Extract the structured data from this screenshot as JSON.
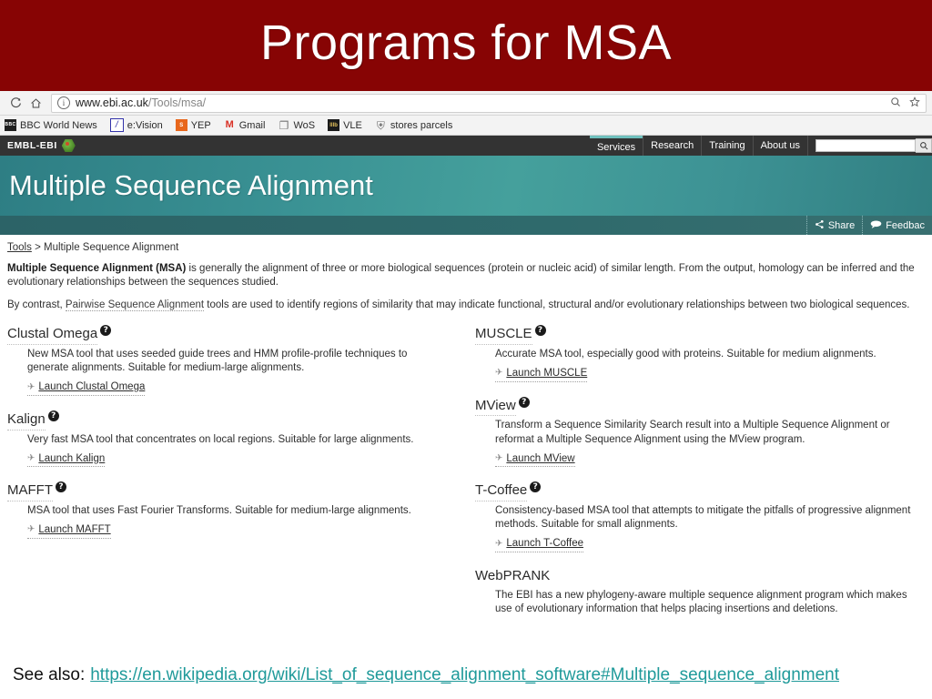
{
  "slide": {
    "title": "Programs for MSA",
    "title_bg": "#870404",
    "see_also_label": "See also:",
    "see_also_link": "https://en.wikipedia.org/wiki/List_of_sequence_alignment_software#Multiple_sequence_alignment",
    "link_color": "#1f9a9a"
  },
  "browser": {
    "reload_icon": "reload-icon",
    "home_icon": "home-icon",
    "info_icon": "info-icon",
    "url_host": "www.ebi.ac.uk",
    "url_path": "/Tools/msa/",
    "zoom_out_icon": "zoom-out-icon",
    "star_icon": "star-icon",
    "bookmarks": [
      {
        "label": "BBC World News",
        "icon": "bbc-icon",
        "glyph": "BBC"
      },
      {
        "label": "e:Vision",
        "icon": "evision-icon",
        "glyph": "/"
      },
      {
        "label": "YEP",
        "icon": "yep-icon",
        "glyph": "S"
      },
      {
        "label": "Gmail",
        "icon": "gmail-icon",
        "glyph": "M"
      },
      {
        "label": "WoS",
        "icon": "wos-page-icon",
        "glyph": "❐"
      },
      {
        "label": "VLE",
        "icon": "vle-icon",
        "glyph": "lllb"
      },
      {
        "label": "stores parcels",
        "icon": "shield-icon",
        "glyph": "⛨"
      }
    ]
  },
  "site": {
    "brand": "EMBL-EBI",
    "brand_logo_icon": "embl-ebi-hexagon-logo",
    "nav": [
      {
        "label": "Services",
        "active": true
      },
      {
        "label": "Research",
        "active": false
      },
      {
        "label": "Training",
        "active": false
      },
      {
        "label": "About us",
        "active": false
      }
    ],
    "search_placeholder": "",
    "search_value": "",
    "search_icon": "search-icon",
    "hero_title": "Multiple Sequence Alignment",
    "hero_color": "#3a9294",
    "share_label": "Share",
    "share_icon": "share-icon",
    "feedback_label": "Feedbac",
    "feedback_icon": "speech-bubble-icon"
  },
  "page": {
    "breadcrumb_root": "Tools",
    "breadcrumb_sep": ">",
    "breadcrumb_current": "Multiple Sequence Alignment",
    "intro_bold": "Multiple Sequence Alignment (MSA)",
    "intro_rest": " is generally the alignment of three or more biological sequences (protein or nucleic acid) of similar length. From the output, homology can be inferred and the evolutionary relationships between the sequences studied.",
    "contrast_pre": "By contrast, ",
    "contrast_link": "Pairwise Sequence Alignment",
    "contrast_post": " tools are used to identify regions of similarity that may indicate functional, structural and/or evolutionary relationships between two biological sequences.",
    "help_icon": "help-question-icon",
    "launch_icon": "wrench-icon"
  },
  "tools_left": [
    {
      "name": "Clustal Omega",
      "has_help": true,
      "description": "New MSA tool that uses seeded guide trees and HMM profile-profile techniques to generate alignments. Suitable for medium-large alignments.",
      "launch": "Launch Clustal Omega"
    },
    {
      "name": "Kalign",
      "has_help": true,
      "description": "Very fast MSA tool that concentrates on local regions. Suitable for large alignments.",
      "launch": "Launch Kalign"
    },
    {
      "name": "MAFFT",
      "has_help": true,
      "description": "MSA tool that uses Fast Fourier Transforms. Suitable for medium-large alignments.",
      "launch": "Launch MAFFT"
    }
  ],
  "tools_right": [
    {
      "name": "MUSCLE",
      "has_help": true,
      "description": "Accurate MSA tool, especially good with proteins. Suitable for medium alignments.",
      "launch": "Launch MUSCLE"
    },
    {
      "name": "MView",
      "has_help": true,
      "description": "Transform a Sequence Similarity Search result into a Multiple Sequence Alignment or reformat a Multiple Sequence Alignment using the MView program.",
      "launch": "Launch MView"
    },
    {
      "name": "T-Coffee",
      "has_help": true,
      "description": "Consistency-based MSA tool that attempts to mitigate the pitfalls of progressive alignment methods. Suitable for small alignments.",
      "launch": "Launch T-Coffee"
    },
    {
      "name": "WebPRANK",
      "has_help": false,
      "description": "The EBI has a new phylogeny-aware multiple sequence alignment program which makes use of evolutionary information that helps placing insertions and deletions.",
      "launch": ""
    }
  ]
}
